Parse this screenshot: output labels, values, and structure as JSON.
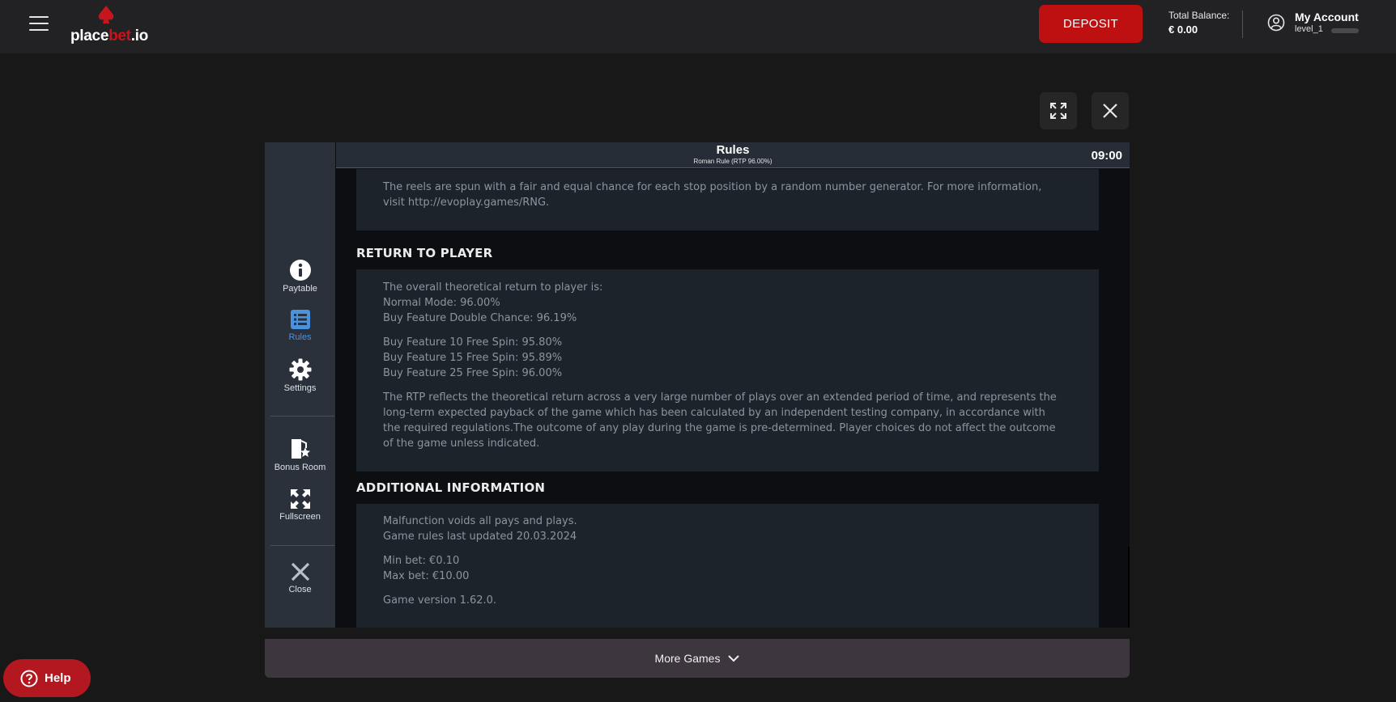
{
  "header": {
    "logo_white": "place",
    "logo_red": "bet",
    "logo_tld": ".io",
    "deposit_label": "DEPOSIT",
    "balance_label": "Total Balance:",
    "balance_value": "€ 0.00",
    "account_title": "My Account",
    "account_level": "level_1"
  },
  "colors": {
    "accent": "#be1010",
    "active": "#4b92de",
    "sidebar": "#2a313b"
  },
  "sidebar": {
    "items": [
      {
        "label": "Paytable",
        "icon": "info-icon"
      },
      {
        "label": "Rules",
        "icon": "list-icon",
        "active": true
      },
      {
        "label": "Settings",
        "icon": "gear-icon"
      },
      {
        "label": "Bonus Room",
        "icon": "bonus-door-icon"
      },
      {
        "label": "Fullscreen",
        "icon": "fullscreen-icon"
      },
      {
        "label": "Close",
        "icon": "close-icon"
      }
    ]
  },
  "rules": {
    "title": "Rules",
    "subtitle": "Roman Rule (RTP 96.00%)",
    "clock": "09:00",
    "rng_text_1": "The reels are spun with a fair and equal chance for each stop position by a random number generator. For more information,",
    "rng_text_2": "visit http://evoplay.games/RNG.",
    "rtp_title": "RETURN TO PLAYER",
    "rtp_lines_1": [
      "The overall theoretical return to player is:",
      "Normal Mode: 96.00%",
      "Buy Feature Double Chance: 96.19%"
    ],
    "rtp_lines_2": [
      "Buy Feature 10 Free Spin: 95.80%",
      "Buy Feature 15 Free Spin: 95.89%",
      "Buy Feature 25 Free Spin: 96.00%"
    ],
    "rtp_para_lines": [
      "The RTP reflects the theoretical return across a very large number of plays over an extended period of time, and represents the",
      "long-term expected payback of the game which has been calculated by an independent testing company, in accordance with",
      "the required regulations.The outcome of any play during the game is pre-determined. Player choices do not affect the outcome",
      "of the game unless indicated."
    ],
    "add_title": "ADDITIONAL INFORMATION",
    "add_lines_1": [
      "Malfunction voids all pays and plays.",
      "Game rules last updated 20.03.2024"
    ],
    "add_lines_2": [
      "Min bet: €0.10",
      "Max bet: €10.00"
    ],
    "add_version": "Game version 1.62.0."
  },
  "footer": {
    "more_games": "More Games",
    "help": "Help"
  }
}
